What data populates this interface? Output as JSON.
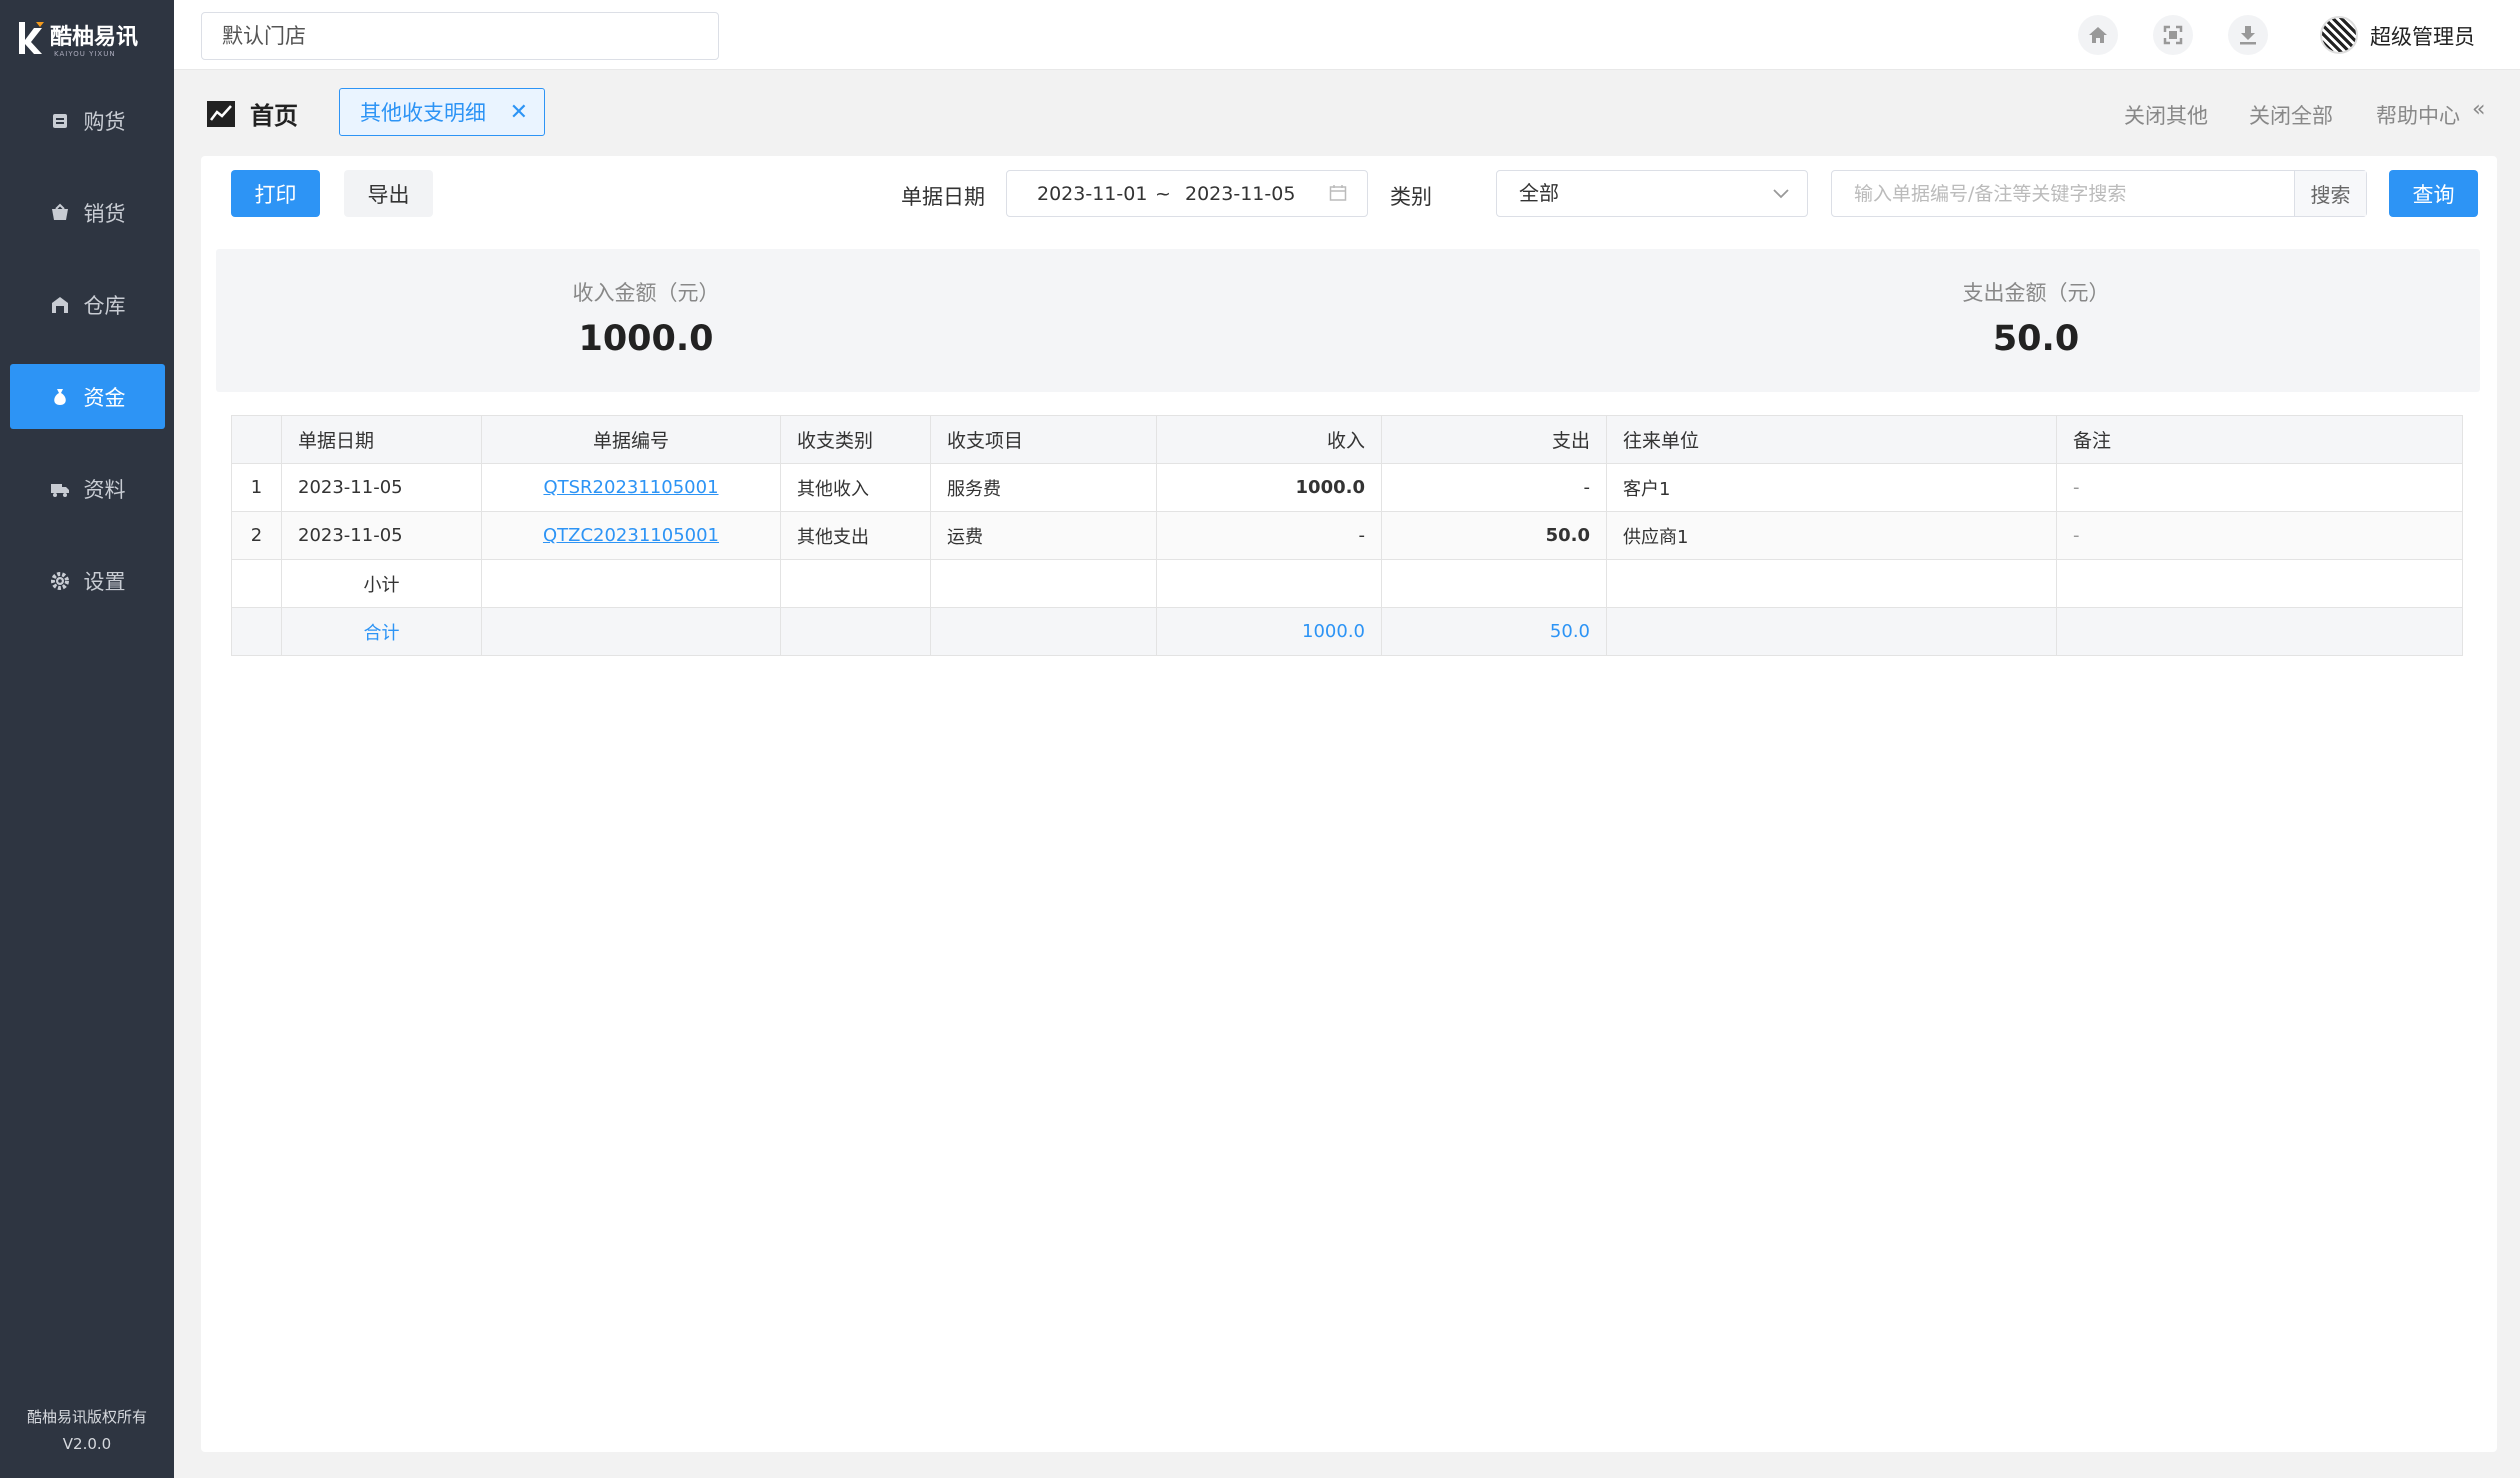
{
  "sidebar": {
    "logo_text": "酷柚易讯",
    "logo_sub": "KAIYOU YIXUN",
    "items": [
      {
        "label": "购货",
        "icon": "list-icon"
      },
      {
        "label": "销货",
        "icon": "basket-icon"
      },
      {
        "label": "仓库",
        "icon": "warehouse-icon"
      },
      {
        "label": "资金",
        "icon": "money-bag-icon",
        "active": true
      },
      {
        "label": "资料",
        "icon": "truck-icon"
      },
      {
        "label": "设置",
        "icon": "gear-icon"
      }
    ],
    "copyright": "酷柚易讯版权所有",
    "version": "V2.0.0"
  },
  "topbar": {
    "store": "默认门店",
    "icons": [
      "home-icon",
      "fullscreen-icon",
      "download-icon"
    ],
    "user": "超级管理员"
  },
  "tabs": {
    "home": "首页",
    "active": "其他收支明细",
    "close_others": "关闭其他",
    "close_all": "关闭全部",
    "help": "帮助中心"
  },
  "toolbar": {
    "print": "打印",
    "export": "导出",
    "date_label": "单据日期",
    "date_start": "2023-11-01",
    "date_sep": "~",
    "date_end": "2023-11-05",
    "category_label": "类别",
    "category_value": "全部",
    "search_placeholder": "输入单据编号/备注等关键字搜索",
    "search_button": "搜索",
    "query": "查询"
  },
  "summary": {
    "income_label": "收入金额（元）",
    "income_value": "1000.0",
    "expense_label": "支出金额（元）",
    "expense_value": "50.0"
  },
  "table": {
    "headers": [
      "",
      "单据日期",
      "单据编号",
      "收支类别",
      "收支项目",
      "收入",
      "支出",
      "往来单位",
      "备注"
    ],
    "rows": [
      {
        "no": "1",
        "date": "2023-11-05",
        "code": "QTSR20231105001",
        "type": "其他收入",
        "item": "服务费",
        "income": "1000.0",
        "expense": "-",
        "party": "客户1",
        "note": "-"
      },
      {
        "no": "2",
        "date": "2023-11-05",
        "code": "QTZC20231105001",
        "type": "其他支出",
        "item": "运费",
        "income": "-",
        "expense": "50.0",
        "party": "供应商1",
        "note": "-"
      }
    ],
    "subtotal_label": "小计",
    "total_label": "合计",
    "total_income": "1000.0",
    "total_expense": "50.0"
  }
}
